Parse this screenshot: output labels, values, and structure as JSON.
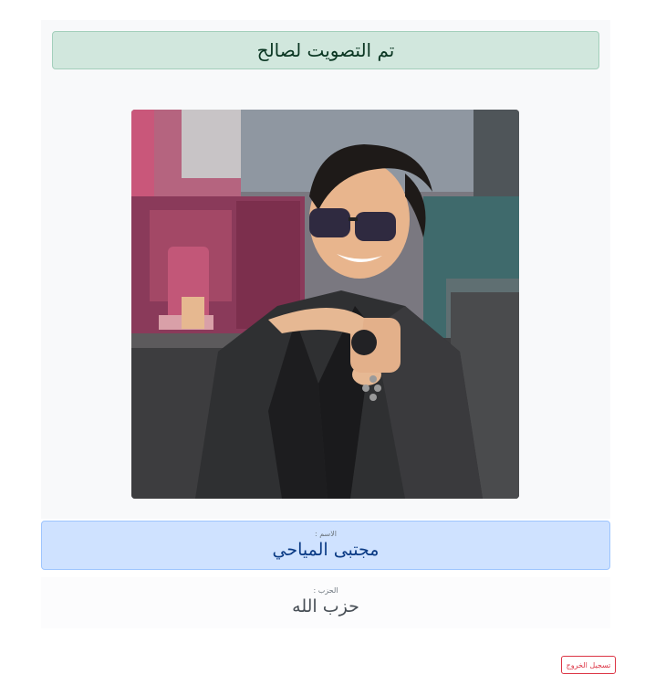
{
  "vote": {
    "banner_text": "تم التصويت لصالح"
  },
  "candidate": {
    "photo_subject": "candidate-photo",
    "name_label": "الاسم :",
    "name": "مجتبى المياحي",
    "party_label": "الحزب :",
    "party": "حزب الله"
  },
  "actions": {
    "logout_label": "تسجيل الخروج"
  },
  "colors": {
    "success_bg": "#d1e7dd",
    "primary_bg": "#cfe2ff",
    "danger": "#dc3545"
  }
}
